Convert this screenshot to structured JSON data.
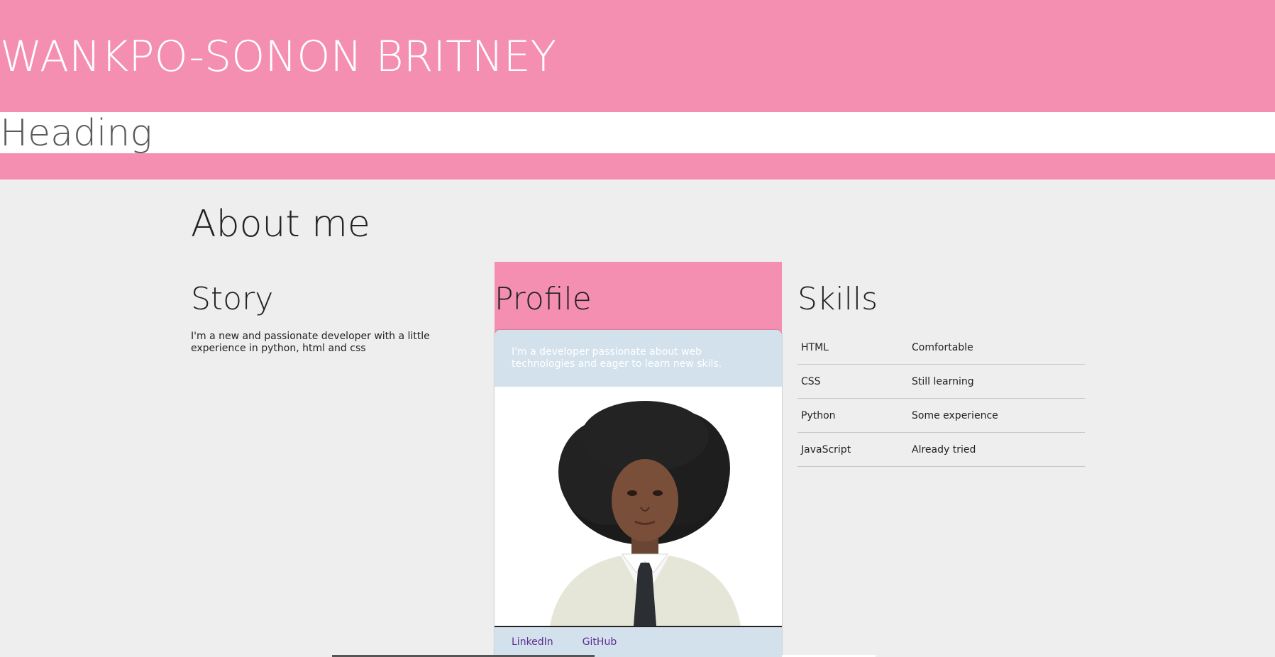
{
  "header": {
    "title": "WANKPO-SONON BRITNEY"
  },
  "heading_bar": {
    "text": "Heading"
  },
  "about": {
    "title": "About me"
  },
  "story": {
    "title": "Story",
    "text": "I'm a new and passionate developer with a little experience in python, html and css"
  },
  "profile": {
    "title": "Profile",
    "description": "I'm a developer passionate about web technologies and eager to learn new skils.",
    "links": [
      "LinkedIn",
      "GitHub"
    ]
  },
  "skills": {
    "title": "Skills",
    "rows": [
      {
        "name": "HTML",
        "level": "Comfortable"
      },
      {
        "name": "CSS",
        "level": "Still learning"
      },
      {
        "name": "Python",
        "level": "Some experience"
      },
      {
        "name": "JavaScript",
        "level": "Already tried"
      }
    ]
  },
  "colors": {
    "accent": "#f48fb1",
    "card_blue": "#d3e1ec",
    "link": "#5c2d91"
  }
}
